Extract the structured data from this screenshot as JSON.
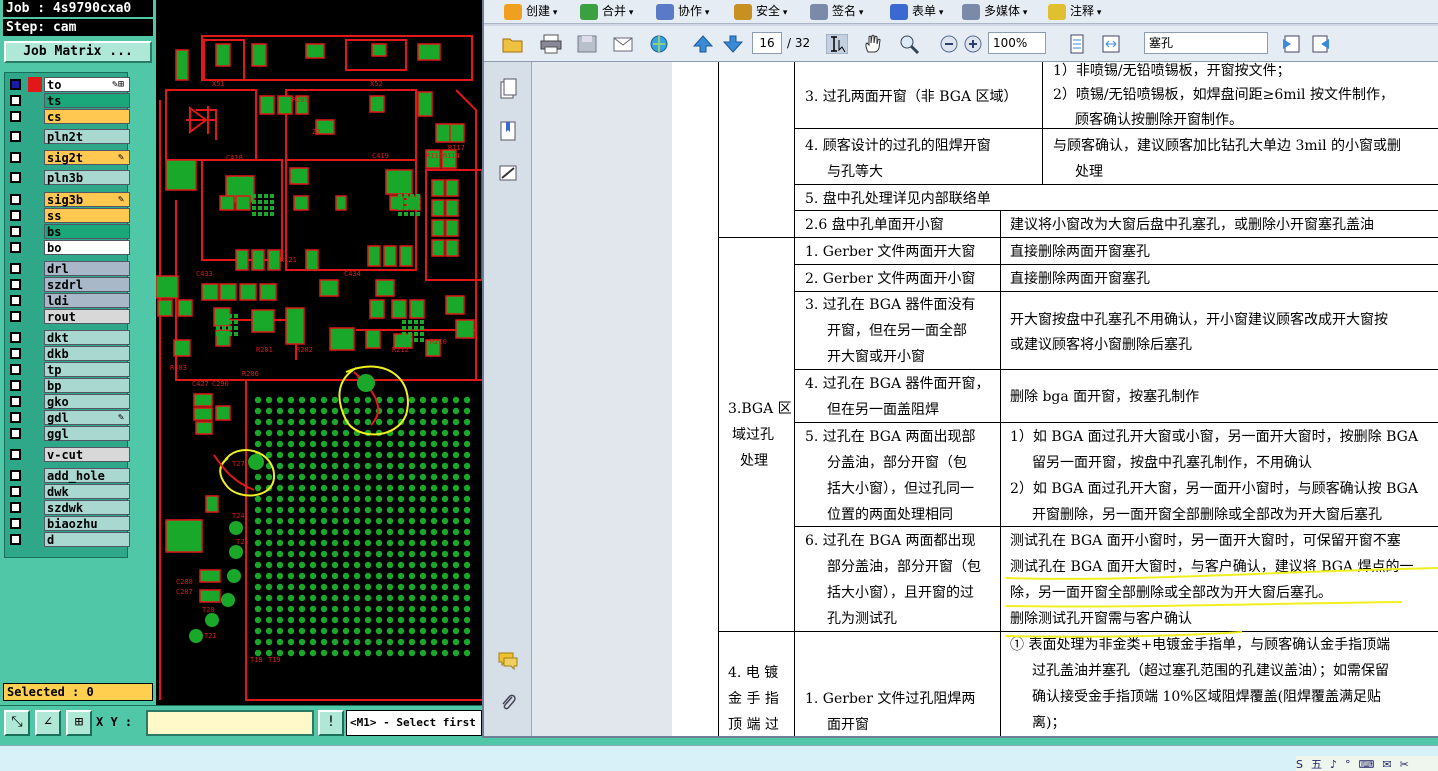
{
  "cam": {
    "job": "Job : 4s9790cxa0",
    "step": "Step: cam",
    "job_matrix": "Job Matrix ...",
    "selected": "Selected : 0",
    "xy_label": "X Y :",
    "message": "<M1> - Select first"
  },
  "layers": [
    {
      "name": "to",
      "color": "#ffffff",
      "active": true,
      "lock": "✎⊞"
    },
    {
      "name": "ts",
      "color": "#1aa87a",
      "active": false,
      "lock": ""
    },
    {
      "name": "cs",
      "color": "#ffc850",
      "active": false,
      "lock": ""
    },
    {
      "name": "pln2t",
      "color": "#a8d8d0",
      "active": false,
      "lock": ""
    },
    {
      "name": "sig2t",
      "color": "#ffc850",
      "active": false,
      "lock": "✎"
    },
    {
      "name": "pln3b",
      "color": "#a8d8d0",
      "active": false,
      "lock": ""
    },
    {
      "name": "sig3b",
      "color": "#ffc850",
      "active": false,
      "lock": "✎"
    },
    {
      "name": "ss",
      "color": "#ffc850",
      "active": false,
      "lock": ""
    },
    {
      "name": "bs",
      "color": "#1aa87a",
      "active": false,
      "lock": ""
    },
    {
      "name": "bo",
      "color": "#ffffff",
      "active": false,
      "lock": ""
    },
    {
      "name": "drl",
      "color": "#a8b8c8",
      "active": false,
      "lock": ""
    },
    {
      "name": "szdrl",
      "color": "#a8b8c8",
      "active": false,
      "lock": ""
    },
    {
      "name": "ldi",
      "color": "#a8b8c8",
      "active": false,
      "lock": ""
    },
    {
      "name": "rout",
      "color": "#d8d8d8",
      "active": false,
      "lock": ""
    },
    {
      "name": "dkt",
      "color": "#a8d8d0",
      "active": false,
      "lock": ""
    },
    {
      "name": "dkb",
      "color": "#a8d8d0",
      "active": false,
      "lock": ""
    },
    {
      "name": "tp",
      "color": "#a8d8d0",
      "active": false,
      "lock": ""
    },
    {
      "name": "bp",
      "color": "#a8d8d0",
      "active": false,
      "lock": ""
    },
    {
      "name": "gko",
      "color": "#a8d8d0",
      "active": false,
      "lock": ""
    },
    {
      "name": "gdl",
      "color": "#a8d8d0",
      "active": false,
      "lock": "✎"
    },
    {
      "name": "ggl",
      "color": "#a8d8d0",
      "active": false,
      "lock": ""
    },
    {
      "name": "v-cut",
      "color": "#d8d8d8",
      "active": false,
      "lock": ""
    },
    {
      "name": "add_hole",
      "color": "#a8d8d0",
      "active": false,
      "lock": ""
    },
    {
      "name": "dwk",
      "color": "#a8d8d0",
      "active": false,
      "lock": ""
    },
    {
      "name": "szdwk",
      "color": "#a8d8d0",
      "active": false,
      "lock": ""
    },
    {
      "name": "biaozhu",
      "color": "#a8d8d0",
      "active": false,
      "lock": ""
    },
    {
      "name": "d",
      "color": "#a8d8d0",
      "active": false,
      "lock": ""
    }
  ],
  "pcb_labels": [
    "X51",
    "X52",
    "R205",
    "Z7",
    "C418",
    "C419",
    "R116R114",
    "R117",
    "R121",
    "C433",
    "C434",
    "R210",
    "R212",
    "R201",
    "R202",
    "R403",
    "C427",
    "C290",
    "R206",
    "T28",
    "T27",
    "T24",
    "T25",
    "C288",
    "C287",
    "T20",
    "T21",
    "T18",
    "T19"
  ],
  "pdf_toolbar1": [
    "创建",
    "合并",
    "协作",
    "安全",
    "签名",
    "表单",
    "多媒体",
    "注释"
  ],
  "pdf_toolbar2": {
    "page_current": "16",
    "page_total": "/ 32",
    "zoom": "100%",
    "search": "塞孔"
  },
  "pdf_table": {
    "r1_col2": "3. 过孔两面开窗（非 BGA 区域）",
    "r1_col3_a": "1）非喷锡/无铅喷锡板，开窗按文件；",
    "r1_col3_b": "2）喷锡/无铅喷锡板，如焊盘间距≥6mil 按文件制作，",
    "r1_col3_c": "顾客确认按删除开窗制作。",
    "r2_col2_a": "4. 顾客设计的过孔的阻焊开窗",
    "r2_col2_b": "与孔等大",
    "r2_col3_a": "与顾客确认，建议顾客加比钻孔大单边 3mil 的小窗或删",
    "r2_col3_b": "处理",
    "r3_col2": "5. 盘中孔处理详见内部联络单",
    "r4_col2": "2.6 盘中孔单面开小窗",
    "r4_col3": "建议将小窗改为大窗后盘中孔塞孔，或删除小开窗塞孔盖油",
    "section3_a": "3.BGA 区",
    "section3_b": "域过孔",
    "section3_c": "处理",
    "s3r1_col2": "1. Gerber 文件两面开大窗",
    "s3r1_col3": "直接删除两面开窗塞孔",
    "s3r2_col2": "2. Gerber 文件两面开小窗",
    "s3r2_col3": "直接删除两面开窗塞孔",
    "s3r3_col2_a": "3. 过孔在 BGA 器件面没有",
    "s3r3_col2_b": "开窗，但在另一面全部",
    "s3r3_col2_c": "开大窗或开小窗",
    "s3r3_col3_a": "开大窗按盘中孔塞孔不用确认，开小窗建议顾客改成开大窗按",
    "s3r3_col3_b": "或建议顾客将小窗删除后塞孔",
    "s3r4_col2_a": "4. 过孔在 BGA 器件面开窗，",
    "s3r4_col2_b": "但在另一面盖阻焊",
    "s3r4_col3": "删除 bga 面开窗，按塞孔制作",
    "s3r5_col2_a": "5. 过孔在 BGA 两面出现部",
    "s3r5_col2_b": "分盖油，部分开窗（包",
    "s3r5_col2_c": "括大小窗），但过孔同一",
    "s3r5_col2_d": "位置的两面处理相同",
    "s3r5_col3_a": "1）如 BGA 面过孔开大窗或小窗，另一面开大窗时，按删除 BGA",
    "s3r5_col3_b": "留另一面开窗，按盘中孔塞孔制作，不用确认",
    "s3r5_col3_c": "2）如 BGA 面过孔开大窗，另一面开小窗时，与顾客确认按 BGA",
    "s3r5_col3_d": "开窗删除，另一面开窗全部删除或全部改为开大窗后塞孔",
    "s3r6_col2_a": "6. 过孔在 BGA 两面都出现",
    "s3r6_col2_b": "部分盖油，部分开窗（包",
    "s3r6_col2_c": "括大小窗），且开窗的过",
    "s3r6_col2_d": "孔为测试孔",
    "s3r6_col3_a": "测试孔在 BGA 面开小窗时，另一面开大窗时，可保留开窗不塞",
    "s3r6_col3_b": "测试孔在 BGA 面开大窗时，与客户确认，建议将 BGA 焊点的一",
    "s3r6_col3_c": "除，另一面开窗全部删除或全部改为开大窗后塞孔。",
    "s3r6_col3_d": "删除测试孔开窗需与客户确认",
    "section4_a": "4. 电 镀",
    "section4_b": "金 手 指",
    "section4_c": "顶 端 过",
    "s4r1_col2_a": "1. Gerber 文件过孔阻焊两",
    "s4r1_col2_b": "面开窗",
    "s4r1_col3_a": "① 表面处理为非金类+电镀金手指单，与顾客确认金手指顶端",
    "s4r1_col3_b": "过孔盖油并塞孔（超过塞孔范围的孔建议盖油）；如需保留",
    "s4r1_col3_c": "确认接受金手指顶端 10%区域阻焊覆盖(阻焊覆盖满足贴",
    "s4r1_col3_d": "离)；"
  },
  "tray": [
    "S",
    "五",
    "♪",
    "°",
    "⌨",
    "✉",
    "✂"
  ],
  "colors": {
    "cam_bg": "#50c8a8",
    "pcb_copper": "#1aa82a",
    "pcb_trace": "#e01818",
    "annotation": "#f0f020",
    "pdf_toolbar": "#e6ecf4"
  }
}
